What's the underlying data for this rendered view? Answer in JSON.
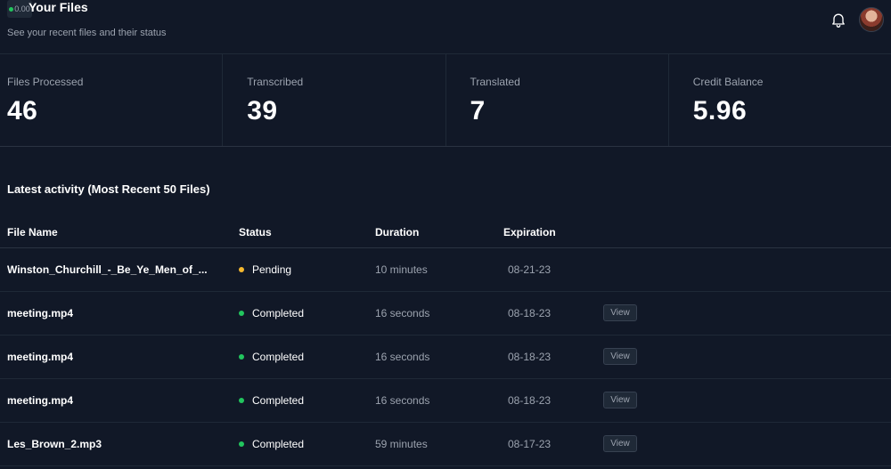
{
  "header": {
    "badge_text": "0.00",
    "title": "Your Files",
    "subtitle": "See your recent files and their status"
  },
  "stats": [
    {
      "label": "Files Processed",
      "value": "46"
    },
    {
      "label": "Transcribed",
      "value": "39"
    },
    {
      "label": "Translated",
      "value": "7"
    },
    {
      "label": "Credit Balance",
      "value": "5.96"
    }
  ],
  "activity": {
    "title": "Latest activity (Most Recent 50 Files)",
    "columns": [
      "File Name",
      "Status",
      "Duration",
      "Expiration"
    ],
    "rows": [
      {
        "name": "Winston_Churchill_-_Be_Ye_Men_of_...",
        "status": "Pending",
        "duration": "10 minutes",
        "expiration": "08-21-23",
        "action": ""
      },
      {
        "name": "meeting.mp4",
        "status": "Completed",
        "duration": "16 seconds",
        "expiration": "08-18-23",
        "action": "View"
      },
      {
        "name": "meeting.mp4",
        "status": "Completed",
        "duration": "16 seconds",
        "expiration": "08-18-23",
        "action": "View"
      },
      {
        "name": "meeting.mp4",
        "status": "Completed",
        "duration": "16 seconds",
        "expiration": "08-18-23",
        "action": "View"
      },
      {
        "name": "Les_Brown_2.mp3",
        "status": "Completed",
        "duration": "59 minutes",
        "expiration": "08-17-23",
        "action": "View"
      }
    ]
  },
  "colors": {
    "pending": "#f5b82e",
    "completed": "#22c55e"
  },
  "icons": {
    "bell": "bell-icon",
    "avatar": "user-avatar"
  }
}
